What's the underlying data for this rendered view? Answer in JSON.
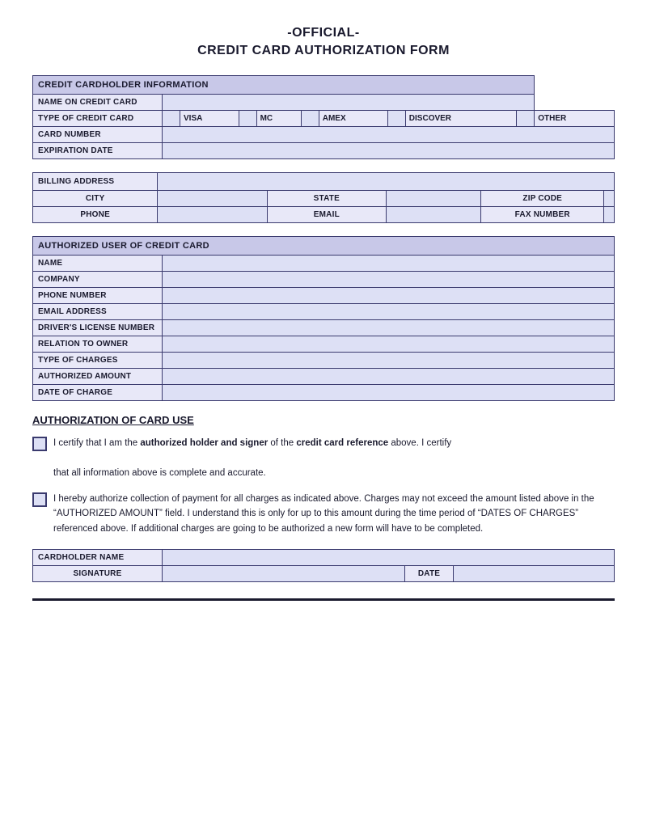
{
  "title": {
    "line1": "-OFFICIAL-",
    "line2": "CREDIT CARD AUTHORIZATION FORM"
  },
  "cardholder_info": {
    "section_header": "CREDIT CARDHOLDER INFORMATION",
    "name_label": "NAME ON CREDIT CARD",
    "type_label": "TYPE OF CREDIT CARD",
    "card_types": [
      "VISA",
      "MC",
      "AMEX",
      "DISCOVER",
      "OTHER"
    ],
    "card_number_label": "CARD NUMBER",
    "expiration_label": "EXPIRATION DATE"
  },
  "billing": {
    "section_header": "BILLING ADDRESS",
    "city_label": "CITY",
    "state_label": "STATE",
    "zip_label": "ZIP CODE",
    "phone_label": "PHONE",
    "email_label": "EMAIL",
    "fax_label": "FAX NUMBER"
  },
  "authorized_user": {
    "section_header": "AUTHORIZED USER OF CREDIT CARD",
    "fields": [
      "NAME",
      "COMPANY",
      "PHONE NUMBER",
      "EMAIL ADDRESS",
      "DRIVER'S LICENSE NUMBER",
      "RELATION TO OWNER",
      "TYPE OF CHARGES",
      "AUTHORIZED AMOUNT",
      "DATE OF CHARGE"
    ]
  },
  "authorization": {
    "title": "AUTHORIZATION OF CARD USE",
    "cert1": "I certify that I am the authorized holder and signer of the credit card reference above. I certify that all information above is complete and accurate.",
    "cert1_bold": "authorized holder and signer",
    "cert2": "I hereby authorize collection of payment for all charges as indicated above. Charges may not exceed the amount listed above in the “AUTHORIZED AMOUNT” field. I understand this is only for up to this amount during the time period of “DATES OF CHARGES” referenced above. If additional charges are going to be authorized a new form will have to be completed."
  },
  "signature_section": {
    "cardholder_label": "CARDHOLDER NAME",
    "signature_label": "SIGNATURE",
    "date_label": "DATE"
  }
}
